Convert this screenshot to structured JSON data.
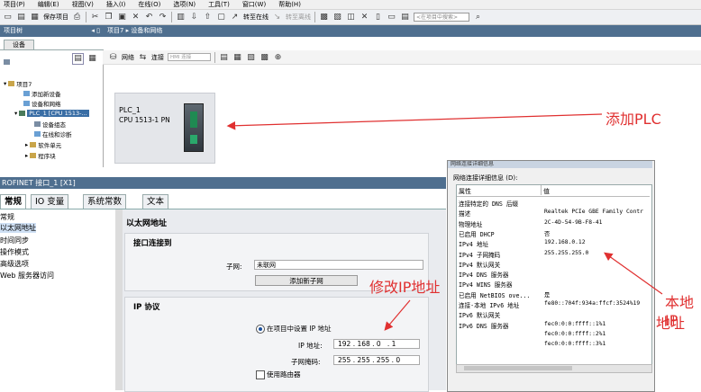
{
  "menu": [
    "项目(P)",
    "编辑(E)",
    "视图(V)",
    "插入(I)",
    "在线(O)",
    "选项(N)",
    "工具(T)",
    "窗口(W)",
    "帮助(H)"
  ],
  "toolbar": {
    "save_project": "保存项目",
    "go_online": "转至在线",
    "go_offline": "转至离线",
    "search_placeholder": "<在项目中搜索>"
  },
  "tree": {
    "header": "项目树",
    "tab": "设备",
    "items": [
      "项目7",
      "添加新设备",
      "设备和网络",
      "PLC_1 [CPU 1513-...",
      "设备组态",
      "在线和诊断",
      "软件单元",
      "程序块"
    ]
  },
  "device_view": {
    "breadcrumb": "项目7 ▸ 设备和网络",
    "network_btn": "网络",
    "connect_btn": "连接",
    "hmi_select": "HMI 连接",
    "plc_name": "PLC_1",
    "plc_type": "CPU 1513-1 PN"
  },
  "properties": {
    "title": "ROFINET 接口_1 [X1]",
    "tabs": [
      "常规",
      "IO 变量",
      "系统常数",
      "文本"
    ],
    "nav": [
      "常规",
      "以太网地址",
      "时间同步",
      "操作模式",
      "高级选项",
      "Web 服务器访问"
    ],
    "eth_title": "以太网地址",
    "interface_section": "接口连接到",
    "subnet_label": "子网:",
    "subnet_value": "未联网",
    "add_subnet": "添加新子网",
    "ip_section": "IP 协议",
    "radio_label": "在项目中设置 IP 地址",
    "ip_label": "IP 地址:",
    "ip_value": "192 . 168 . 0   . 1",
    "mask_label": "子网掩码:",
    "mask_value": "255 . 255 . 255 . 0",
    "router_label": "使用路由器"
  },
  "net_dialog": {
    "title": "网络连接详细信息",
    "heading": "网络连接详细信息 (D):",
    "col_prop": "属性",
    "col_val": "值",
    "rows": [
      {
        "p": "连接特定的 DNS 后缀",
        "v": ""
      },
      {
        "p": "描述",
        "v": "Realtek PCIe GBE Family Contr"
      },
      {
        "p": "物理地址",
        "v": "2C-4D-54-9B-F8-41"
      },
      {
        "p": "已启用 DHCP",
        "v": "否"
      },
      {
        "p": "IPv4 地址",
        "v": "192.168.0.12"
      },
      {
        "p": "IPv4 子网掩码",
        "v": "255.255.255.0"
      },
      {
        "p": "IPv4 默认网关",
        "v": ""
      },
      {
        "p": "IPv4 DNS 服务器",
        "v": ""
      },
      {
        "p": "IPv4 WINS 服务器",
        "v": ""
      },
      {
        "p": "已启用 NetBIOS ove...",
        "v": "是"
      },
      {
        "p": "连接-本地 IPv6 地址",
        "v": "fe80::704f:934a:ffcf:3524%19"
      },
      {
        "p": "IPv6 默认网关",
        "v": ""
      },
      {
        "p": "IPv6 DNS 服务器",
        "v": "fec0:0:0:ffff::1%1"
      },
      {
        "p": "",
        "v": "fec0:0:0:ffff::2%1"
      },
      {
        "p": "",
        "v": "fec0:0:0:ffff::3%1"
      }
    ]
  },
  "annotations": {
    "add_plc": "添加PLC",
    "modify_ip": "修改IP地址",
    "local_ip_1": "本地IP",
    "local_ip_2": "地址"
  },
  "colors": {
    "annotation": "#e03030",
    "header": "#4f6f8f"
  }
}
